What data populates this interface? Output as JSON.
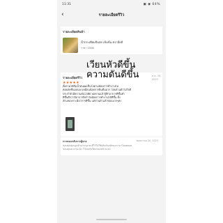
{
  "status_bar": {
    "time": "11:31",
    "icons": "▣ ◉ 64%"
  },
  "header": {
    "title": "รายละเอียดรีวิว",
    "back_icon": "‹"
  },
  "product_section": {
    "title": "รายละเอียดสินค้า",
    "name": "น้ำกระเทียมจีนสด เข้มข้น ตรามือดี",
    "price": "ราคา 550฿"
  },
  "review_section": {
    "title": "รายละเอียดรีวิว",
    "overlay_line1": "เวียนหัวดีขึ้น",
    "overlay_line2": "ความดันดีขึ้น",
    "date": "ส.ค. 30, 2023",
    "stars": "★★★★★",
    "text_lines": [
      "ทั้งตามได้ดื่มน้ำมันผมเซ็นโจตามน้อยการทำงานไม่",
      "ค่อยสดชื่นออนพาเหมือนน้อยการยินดีนมาก โดยส่วนตัวไม่ใจดี",
      "ประจำตัวมีความดันโลหิต พอทานแล้วรู้สึกอาการดีขึ้นทำ",
      "ดีขึ้นดีกว่ามีอาการยิ่งกำลังน้อยการทำงานได้ดีขึ้น ทั้ง",
      "สักเลยเพราะมีอาการดีขึ้น แต่ส่วนตัวแล้วชอบมากๆค่ะ"
    ]
  },
  "reply_section": {
    "title": "การตอบกลับจากผู้ขาย",
    "date": "พฤษภาคม 20, 2023",
    "text_lines": [
      "ขอบคุณคุณลูกค้ามากๆนะคะที่ไว้ใจใช้ผลิตภัณฑ์ของเรามาโดยตลอด",
      "ขอบคุณมากๆนะคะ ไว้เจอกันใหม่รอบหน้านะคะ"
    ]
  }
}
